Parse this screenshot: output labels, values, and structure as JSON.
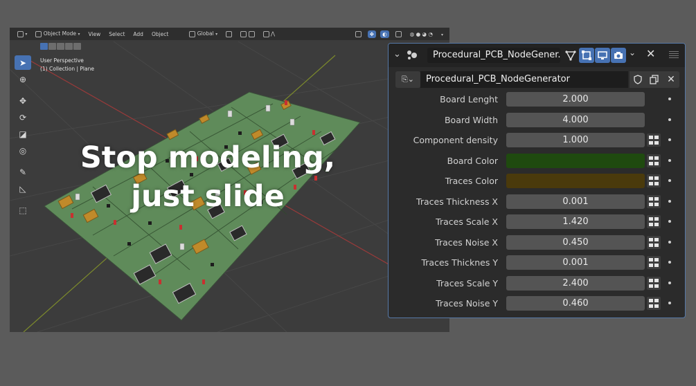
{
  "viewport": {
    "header": {
      "mode_label": "Object Mode",
      "menu": [
        "View",
        "Select",
        "Add",
        "Object"
      ],
      "orientation_label": "Global"
    },
    "info": {
      "perspective": "User Perspective",
      "collection": "(1) Collection | Plane"
    },
    "tools": [
      "select-box",
      "cursor",
      "move",
      "rotate",
      "scale",
      "transform",
      "annotate",
      "measure",
      "add-cube"
    ],
    "overlay": {
      "line1": "Stop modeling,",
      "line2": "just slide"
    },
    "colors": {
      "board": "#5e8a5a",
      "axis_red": "#a03a3a",
      "axis_green": "#7a8a2a"
    }
  },
  "panel": {
    "header_name": "Procedural_PCB_NodeGener...",
    "datablock_name": "Procedural_PCB_NodeGenerator",
    "properties": [
      {
        "label": "Board Lenght",
        "value": "2.000",
        "socket": false
      },
      {
        "label": "Board Width",
        "value": "4.000",
        "socket": false
      },
      {
        "label": "Component density",
        "value": "1.000",
        "socket": true
      },
      {
        "label": "Board Color",
        "color": "#1f4a0f",
        "socket": true
      },
      {
        "label": "Traces Color",
        "color": "#4a3a0c",
        "socket": true
      },
      {
        "label": "Traces Thickness X",
        "value": "0.001",
        "socket": true
      },
      {
        "label": "Traces Scale X",
        "value": "1.420",
        "socket": true
      },
      {
        "label": "Traces Noise X",
        "value": "0.450",
        "socket": true
      },
      {
        "label": "Traces Thicknes Y",
        "value": "0.001",
        "socket": true
      },
      {
        "label": "Traces Scale Y",
        "value": "2.400",
        "socket": true
      },
      {
        "label": "Traces Noise Y",
        "value": "0.460",
        "socket": true
      }
    ],
    "colors": {
      "accent": "#4772b3",
      "field": "#545454"
    }
  }
}
